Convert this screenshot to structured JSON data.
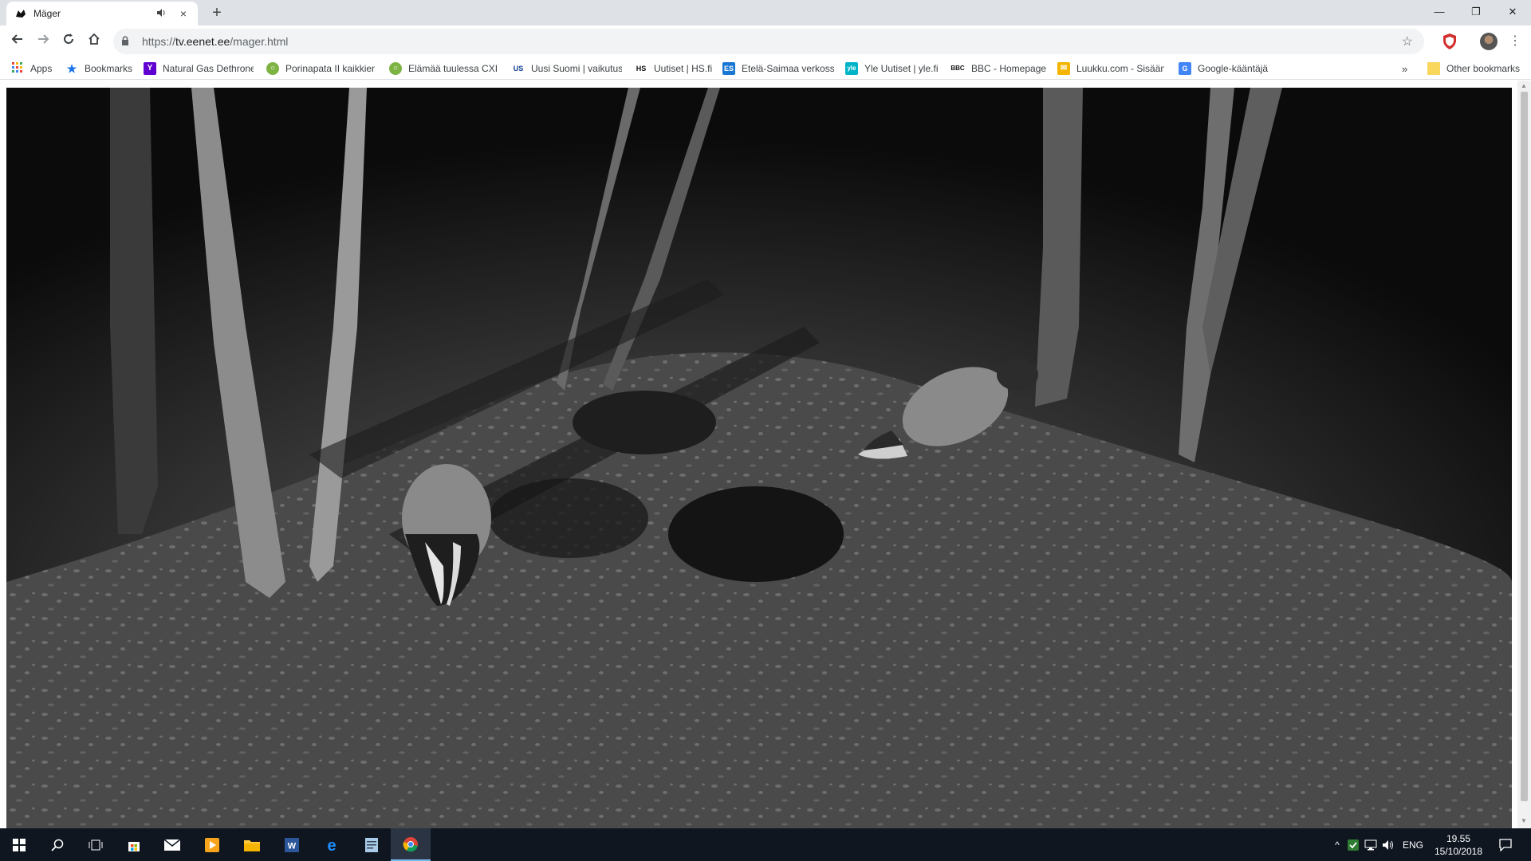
{
  "tab": {
    "title": "Mäger",
    "audio_icon": "speaker-icon",
    "close_label": "×"
  },
  "new_tab_label": "+",
  "window_controls": {
    "minimize": "—",
    "restore": "❐",
    "close": "✕"
  },
  "address_bar": {
    "scheme": "https://",
    "host": "tv.eenet.ee",
    "path": "/mager.html"
  },
  "bookmarks": [
    {
      "label": "Apps",
      "icon": "apps-grid-icon",
      "color": "#ea4335"
    },
    {
      "label": "Bookmarks",
      "icon": "star-icon",
      "color": "#1a73e8"
    },
    {
      "label": "Natural Gas Dethrone",
      "icon": "Y",
      "color": "#5f01d1"
    },
    {
      "label": "Porinapata II kaikkien",
      "icon": "forum-icon",
      "color": "#7cb342"
    },
    {
      "label": "Elämää tuulessa CXIII",
      "icon": "forum-icon",
      "color": "#7cb342"
    },
    {
      "label": "Uusi Suomi | vaikutus",
      "icon": "US",
      "color": "#0b3d91"
    },
    {
      "label": "Uutiset | HS.fi",
      "icon": "HS",
      "color": "#111111"
    },
    {
      "label": "Etelä-Saimaa verkoss",
      "icon": "ES",
      "color": "#1976d2"
    },
    {
      "label": "Yle Uutiset | yle.fi",
      "icon": "yle",
      "color": "#00b4c8"
    },
    {
      "label": "BBC - Homepage",
      "icon": "BBC",
      "color": "#111111"
    },
    {
      "label": "Luukku.com - Sisäänk",
      "icon": "mail-icon",
      "color": "#f4b400"
    },
    {
      "label": "Google-kääntäjä",
      "icon": "translate-icon",
      "color": "#4285f4"
    }
  ],
  "bookmarks_overflow": "»",
  "other_bookmarks": "Other bookmarks",
  "video": {
    "description_icon": "badger-webcam-feed"
  },
  "taskbar": {
    "language": "ENG",
    "time": "19.55",
    "date": "15/10/2018",
    "colors": {
      "accent": "#76b9ed",
      "background": "#0f1620"
    }
  }
}
